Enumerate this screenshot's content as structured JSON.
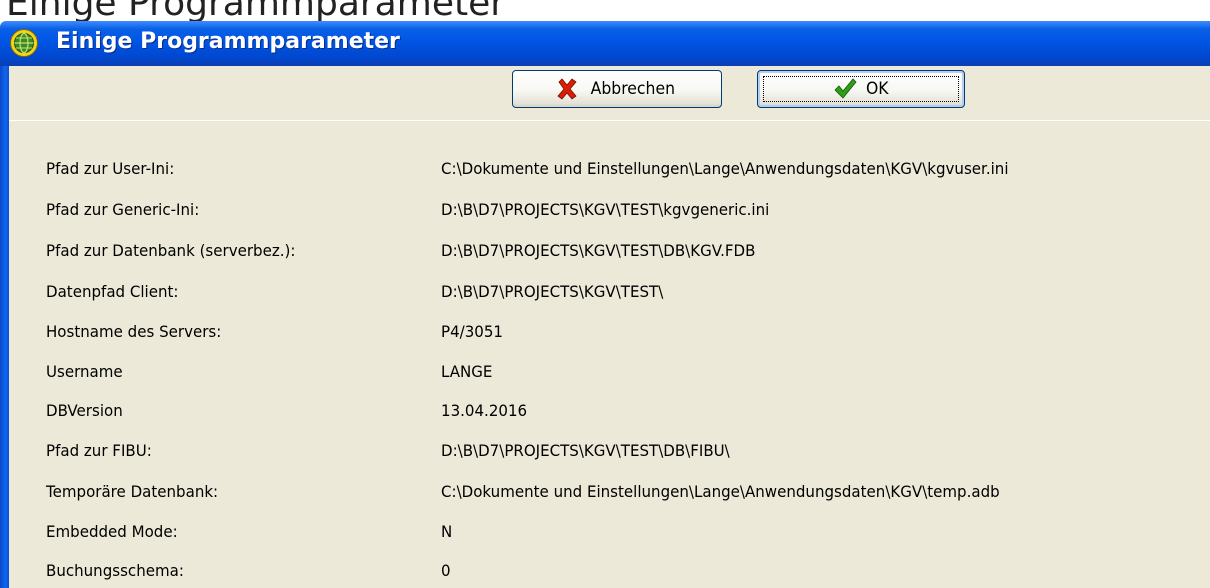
{
  "header_fragment": "Einige Programmparameter",
  "window": {
    "title": "Einige Programmparameter",
    "icon": "app-globe-icon"
  },
  "toolbar": {
    "cancel_label": "Abbrechen",
    "cancel_icon": "red-x-icon",
    "ok_label": "OK",
    "ok_icon": "green-check-icon"
  },
  "params": [
    {
      "label": "Pfad zur User-Ini:",
      "value": "C:\\Dokumente und Einstellungen\\Lange\\Anwendungsdaten\\KGV\\kgvuser.ini"
    },
    {
      "label": "Pfad zur Generic-Ini:",
      "value": "D:\\B\\D7\\PROJECTS\\KGV\\TEST\\kgvgeneric.ini"
    },
    {
      "label": "Pfad zur Datenbank (serverbez.):",
      "value": "D:\\B\\D7\\PROJECTS\\KGV\\TEST\\DB\\KGV.FDB"
    },
    {
      "label": "Datenpfad Client:",
      "value": "D:\\B\\D7\\PROJECTS\\KGV\\TEST\\"
    },
    {
      "label": "Hostname des Servers:",
      "value": "P4/3051"
    },
    {
      "label": "Username",
      "value": "LANGE"
    },
    {
      "label": "DBVersion",
      "value": "13.04.2016"
    },
    {
      "label": "Pfad zur FIBU:",
      "value": "D:\\B\\D7\\PROJECTS\\KGV\\TEST\\DB\\FIBU\\"
    },
    {
      "label": "Temporäre Datenbank:",
      "value": "C:\\Dokumente und Einstellungen\\Lange\\Anwendungsdaten\\KGV\\temp.adb"
    },
    {
      "label": "Embedded Mode:",
      "value": "N"
    },
    {
      "label": "Buchungsschema:",
      "value": "0"
    }
  ],
  "colors": {
    "titlebar": "#0055e5",
    "dialog_bg": "#ece9d8",
    "button_border": "#003c74",
    "cancel_icon": "#d81e05",
    "ok_icon": "#2e9e18"
  }
}
